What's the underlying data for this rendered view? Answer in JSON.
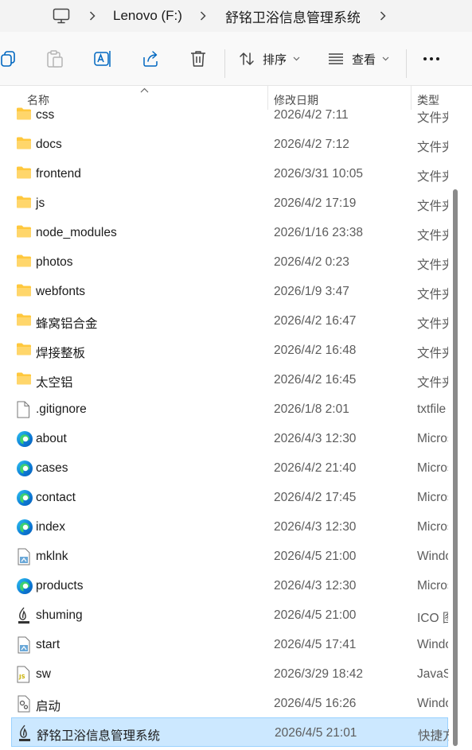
{
  "breadcrumb": {
    "icon": "this-pc-icon",
    "items": [
      "Lenovo (F:)",
      "舒铭卫浴信息管理系统"
    ]
  },
  "toolbar": {
    "buttons": [
      "copy-icon",
      "paste-icon",
      "rename-icon",
      "share-icon",
      "delete-icon"
    ],
    "sort_label": "排序",
    "view_label": "查看",
    "more_icon": "more-icon"
  },
  "columns": {
    "name": "名称",
    "date": "修改日期",
    "type": "类型"
  },
  "files": [
    {
      "name": "css",
      "date": "2026/4/2 7:11",
      "type": "文件夹",
      "icon": "folder"
    },
    {
      "name": "docs",
      "date": "2026/4/2 7:12",
      "type": "文件夹",
      "icon": "folder"
    },
    {
      "name": "frontend",
      "date": "2026/3/31 10:05",
      "type": "文件夹",
      "icon": "folder"
    },
    {
      "name": "js",
      "date": "2026/4/2 17:19",
      "type": "文件夹",
      "icon": "folder"
    },
    {
      "name": "node_modules",
      "date": "2026/1/16 23:38",
      "type": "文件夹",
      "icon": "folder"
    },
    {
      "name": "photos",
      "date": "2026/4/2 0:23",
      "type": "文件夹",
      "icon": "folder"
    },
    {
      "name": "webfonts",
      "date": "2026/1/9 3:47",
      "type": "文件夹",
      "icon": "folder"
    },
    {
      "name": "蜂窝铝合金",
      "date": "2026/4/2 16:47",
      "type": "文件夹",
      "icon": "folder"
    },
    {
      "name": "焊接整板",
      "date": "2026/4/2 16:48",
      "type": "文件夹",
      "icon": "folder"
    },
    {
      "name": "太空铝",
      "date": "2026/4/2 16:45",
      "type": "文件夹",
      "icon": "folder"
    },
    {
      "name": ".gitignore",
      "date": "2026/1/8 2:01",
      "type": "txtfile",
      "icon": "file"
    },
    {
      "name": "about",
      "date": "2026/4/3 12:30",
      "type": "Microsoft",
      "icon": "edge"
    },
    {
      "name": "cases",
      "date": "2026/4/2 21:40",
      "type": "Microsoft",
      "icon": "edge"
    },
    {
      "name": "contact",
      "date": "2026/4/2 17:45",
      "type": "Microsoft",
      "icon": "edge"
    },
    {
      "name": "index",
      "date": "2026/4/3 12:30",
      "type": "Microsoft",
      "icon": "edge"
    },
    {
      "name": "mklnk",
      "date": "2026/4/5 21:00",
      "type": "Windows",
      "icon": "script"
    },
    {
      "name": "products",
      "date": "2026/4/3 12:30",
      "type": "Microsoft",
      "icon": "edge"
    },
    {
      "name": "shuming",
      "date": "2026/4/5 21:00",
      "type": "ICO 图片",
      "icon": "logo"
    },
    {
      "name": "start",
      "date": "2026/4/5 17:41",
      "type": "Windows",
      "icon": "script"
    },
    {
      "name": "sw",
      "date": "2026/3/29 18:42",
      "type": "JavaScript",
      "icon": "js"
    },
    {
      "name": "启动",
      "date": "2026/4/5 16:26",
      "type": "Windows",
      "icon": "gear-file"
    },
    {
      "name": "舒铭卫浴信息管理系统",
      "date": "2026/4/5 21:01",
      "type": "快捷方式",
      "icon": "logo",
      "selected": true
    }
  ],
  "colors": {
    "selection": "#cce8ff",
    "selection_border": "#99d1ff",
    "folder": "#ffc83d",
    "accent": "#0067c0"
  }
}
